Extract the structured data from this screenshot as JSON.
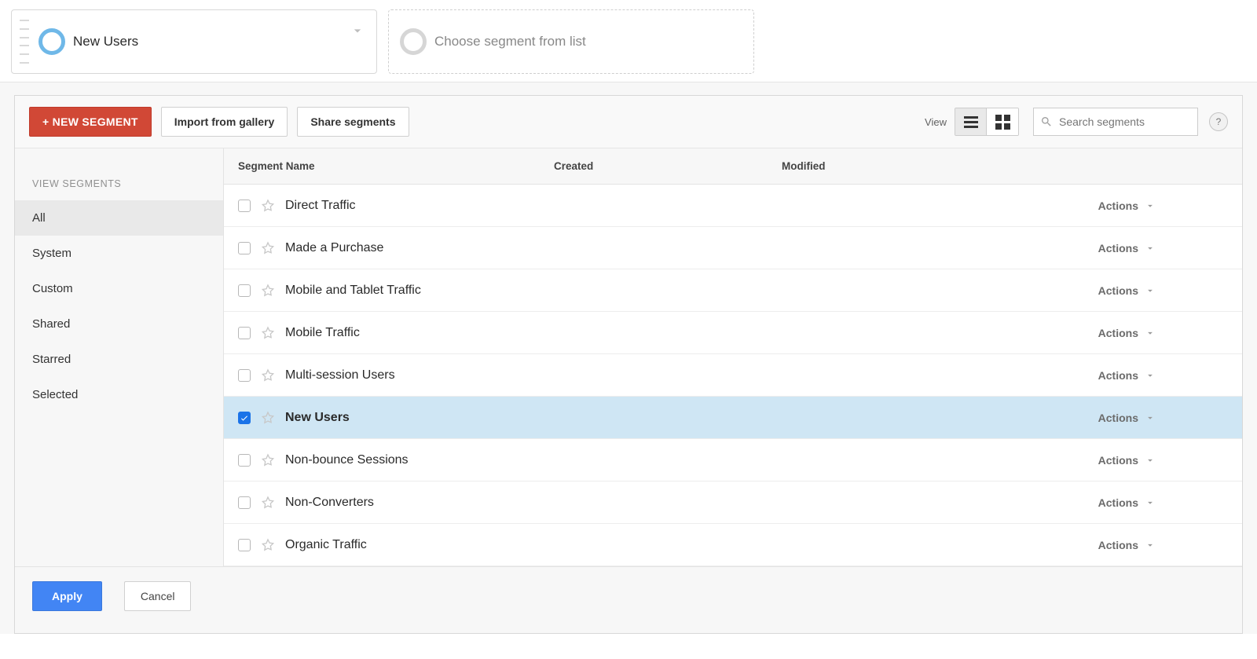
{
  "top_segments": {
    "active": {
      "label": "New Users"
    },
    "placeholder": {
      "label": "Choose segment from list"
    }
  },
  "toolbar": {
    "new_segment": "+ NEW SEGMENT",
    "import_gallery": "Import from gallery",
    "share_segments": "Share segments",
    "view_label": "View",
    "search_placeholder": "Search segments",
    "help_label": "?"
  },
  "sidebar": {
    "heading": "VIEW SEGMENTS",
    "items": [
      {
        "label": "All",
        "active": true
      },
      {
        "label": "System",
        "active": false
      },
      {
        "label": "Custom",
        "active": false
      },
      {
        "label": "Shared",
        "active": false
      },
      {
        "label": "Starred",
        "active": false
      },
      {
        "label": "Selected",
        "active": false
      }
    ]
  },
  "table": {
    "columns": {
      "name": "Segment Name",
      "created": "Created",
      "modified": "Modified"
    },
    "actions_label": "Actions",
    "rows": [
      {
        "name": "Direct Traffic",
        "selected": false
      },
      {
        "name": "Made a Purchase",
        "selected": false
      },
      {
        "name": "Mobile and Tablet Traffic",
        "selected": false
      },
      {
        "name": "Mobile Traffic",
        "selected": false
      },
      {
        "name": "Multi-session Users",
        "selected": false
      },
      {
        "name": "New Users",
        "selected": true
      },
      {
        "name": "Non-bounce Sessions",
        "selected": false
      },
      {
        "name": "Non-Converters",
        "selected": false
      },
      {
        "name": "Organic Traffic",
        "selected": false
      }
    ]
  },
  "footer": {
    "apply": "Apply",
    "cancel": "Cancel"
  }
}
